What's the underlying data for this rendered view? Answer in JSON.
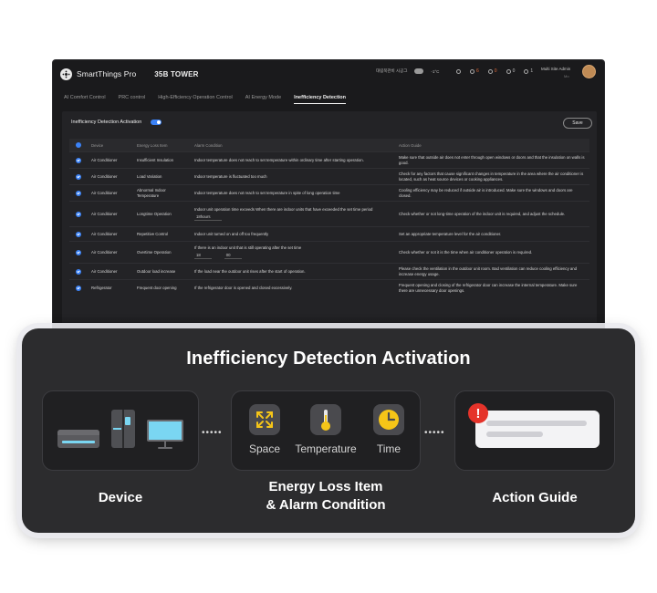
{
  "app": {
    "title": "SmartThings Pro",
    "site": "35B TOWER",
    "location": "대림북관비 시공그",
    "temperature": "-1°C",
    "status_counts": [
      "6",
      "0",
      "0",
      "1"
    ],
    "user_name": "Multi Site Admin",
    "user_sub": "Mo"
  },
  "nav": {
    "tabs": [
      {
        "label": "AI Comfort Control"
      },
      {
        "label": "PRC control"
      },
      {
        "label": "High-Efficiency Operation Control"
      },
      {
        "label": "AI Energy Mode"
      },
      {
        "label": "Inefficiency Detection"
      }
    ]
  },
  "panel": {
    "title": "Inefficiency Detection Activation",
    "toggle_on": true,
    "save_label": "Save"
  },
  "table": {
    "headers": [
      "Device",
      "Energy Loss Item",
      "Alarm Condition",
      "Action Guide"
    ],
    "rows": [
      {
        "device": "Air Conditioner",
        "item": "Insufficient Insulation",
        "condition": "Indoor temperature does not reach to set temperature within ordinary time after starting operation.",
        "guide": "Make sure that outside air does not enter through open windows or doors and that the insulation on walls is good."
      },
      {
        "device": "Air Conditioner",
        "item": "Load Variation",
        "condition": "Indoor temperature is fluctuated too much",
        "guide": "Check for any factors that cause significant changes in temperature in the area where the air conditioner is located, such as heat source devices or cooking appliances."
      },
      {
        "device": "Air Conditioner",
        "item": "Abnormal Indoor Temperature",
        "condition": "Indoor temperature does not reach to set temperature in spite of long operation time",
        "guide": "Cooling efficiency may be reduced if outside air is introduced. Make sure the windows and doors are closed."
      },
      {
        "device": "Air Conditioner",
        "item": "Longtime Operation",
        "condition": "Indoor unit operation time exceeds When there are indoor units that have exceeded the set time period",
        "select1": "18hours",
        "guide": "Check whether or not long-time operation of the indoor unit is required, and adjust the schedule."
      },
      {
        "device": "Air Conditioner",
        "item": "Repetitive Control",
        "condition": "Indoor unit turned on and off too frequently",
        "guide": "Set an appropriate temperature level for the air conditioner."
      },
      {
        "device": "Air Conditioner",
        "item": "Overtime Operation",
        "condition": "If there is an indoor unit that is still operating after the set time",
        "select1": "18",
        "select2": "00",
        "guide": "Check whether or not it is the time when air conditioner operation is required."
      },
      {
        "device": "Air Conditioner",
        "item": "Outdoor load increase",
        "condition": "If the load near the outdoor unit rises after the start of operation.",
        "guide": "Please check the ventilation in the outdoor unit room. Bad ventilation can reduce cooling efficiency and increase energy usage."
      },
      {
        "device": "Refrigerator",
        "item": "Frequent door opening",
        "condition": "If the refrigerator door is opened and closed excessively.",
        "guide": "Frequent opening and closing of the refrigerator door can increase the internal temperature. Make sure there are unnecessary door openings."
      }
    ]
  },
  "overlay": {
    "title": "Inefficiency Detection Activation",
    "items": {
      "space": "Space",
      "temperature": "Temperature",
      "time": "Time"
    },
    "dots": "•••••",
    "labels": {
      "device": "Device",
      "energy_loss_line1": "Energy Loss Item",
      "energy_loss_line2": "& Alarm Condition",
      "action_guide": "Action Guide"
    },
    "alert_mark": "!"
  },
  "colors": {
    "accent": "#3b82f6",
    "cyan": "#7ad6f2",
    "gold": "#f5c518",
    "alert": "#e5332a"
  }
}
